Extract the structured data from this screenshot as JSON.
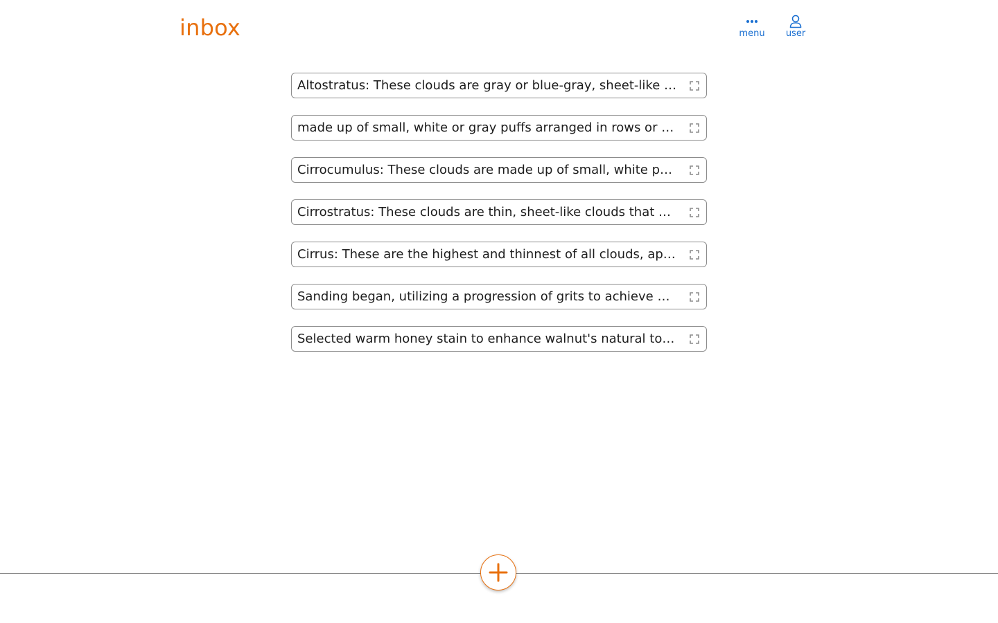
{
  "header": {
    "title": "inbox",
    "menu_label": "menu",
    "user_label": "user"
  },
  "colors": {
    "accent": "#e8700e",
    "link": "#1a6fd1"
  },
  "icons": {
    "menu": "ellipsis-icon",
    "user": "user-icon",
    "expand": "expand-icon",
    "add": "plus-icon"
  },
  "notes": [
    {
      "text": "Altostratus: These clouds are gray or blue-gray, sheet-like clouds that often cover the entire sky."
    },
    {
      "text": "made up of small, white or gray puffs arranged in rows or waves across the sky."
    },
    {
      "text": "Cirrocumulus: These clouds are made up of small, white puffs that appear in rows high in the sky."
    },
    {
      "text": "Cirrostratus: These clouds are thin, sheet-like clouds that cover the entire sky."
    },
    {
      "text": "Cirrus: These are the highest and thinnest of all clouds, appearing wispy and feathery."
    },
    {
      "text": "Sanding began, utilizing a progression of grits to achieve a smooth finish."
    },
    {
      "text": "Selected warm honey stain to enhance walnut's natural tones...."
    }
  ]
}
